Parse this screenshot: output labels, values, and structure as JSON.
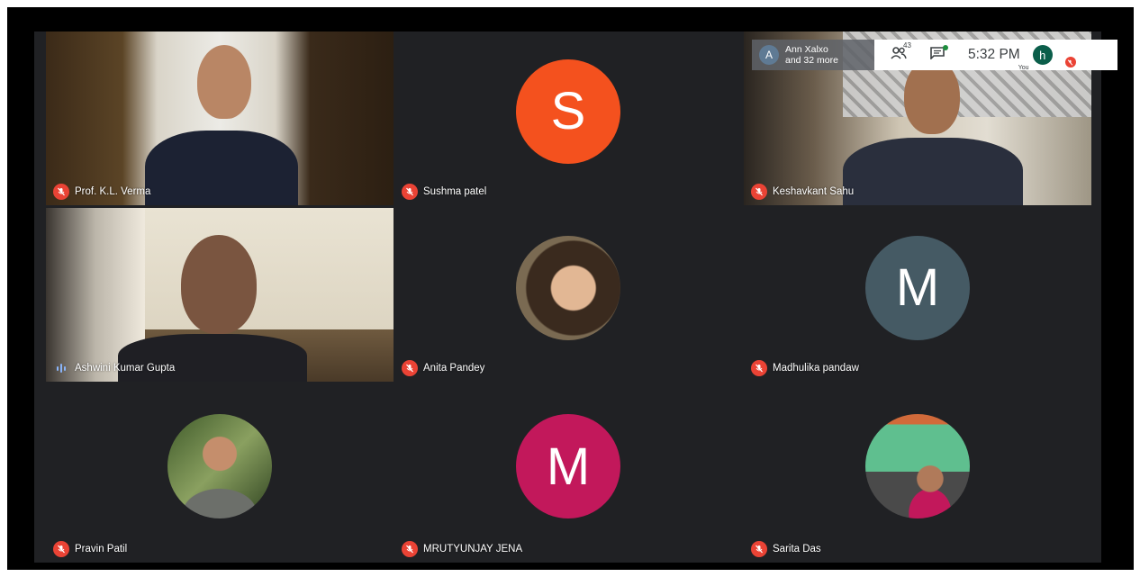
{
  "overlay": {
    "presenter_initial": "A",
    "presenter_line1": "Ann Xalxo",
    "presenter_line2": "and 32 more",
    "participants_count": "43",
    "time": "5:32 PM",
    "self_initial": "h",
    "self_label": "You"
  },
  "tiles": [
    {
      "name": "Prof. K.L. Verma"
    },
    {
      "name": "Sushma patel",
      "initial": "S"
    },
    {
      "name": "Keshavkant Sahu"
    },
    {
      "name": "Ashwini Kumar Gupta"
    },
    {
      "name": "Anita Pandey"
    },
    {
      "name": "Madhulika pandaw",
      "initial": "M"
    },
    {
      "name": "Pravin Patil"
    },
    {
      "name": "MRUTYUNJAY JENA",
      "initial": "M"
    },
    {
      "name": "Sarita Das"
    }
  ],
  "colors": {
    "stage_bg": "#202124",
    "muted_red": "#ea4335",
    "avatar_orange": "#f4511e",
    "avatar_slate": "#455a64",
    "avatar_magenta": "#c2185b"
  }
}
